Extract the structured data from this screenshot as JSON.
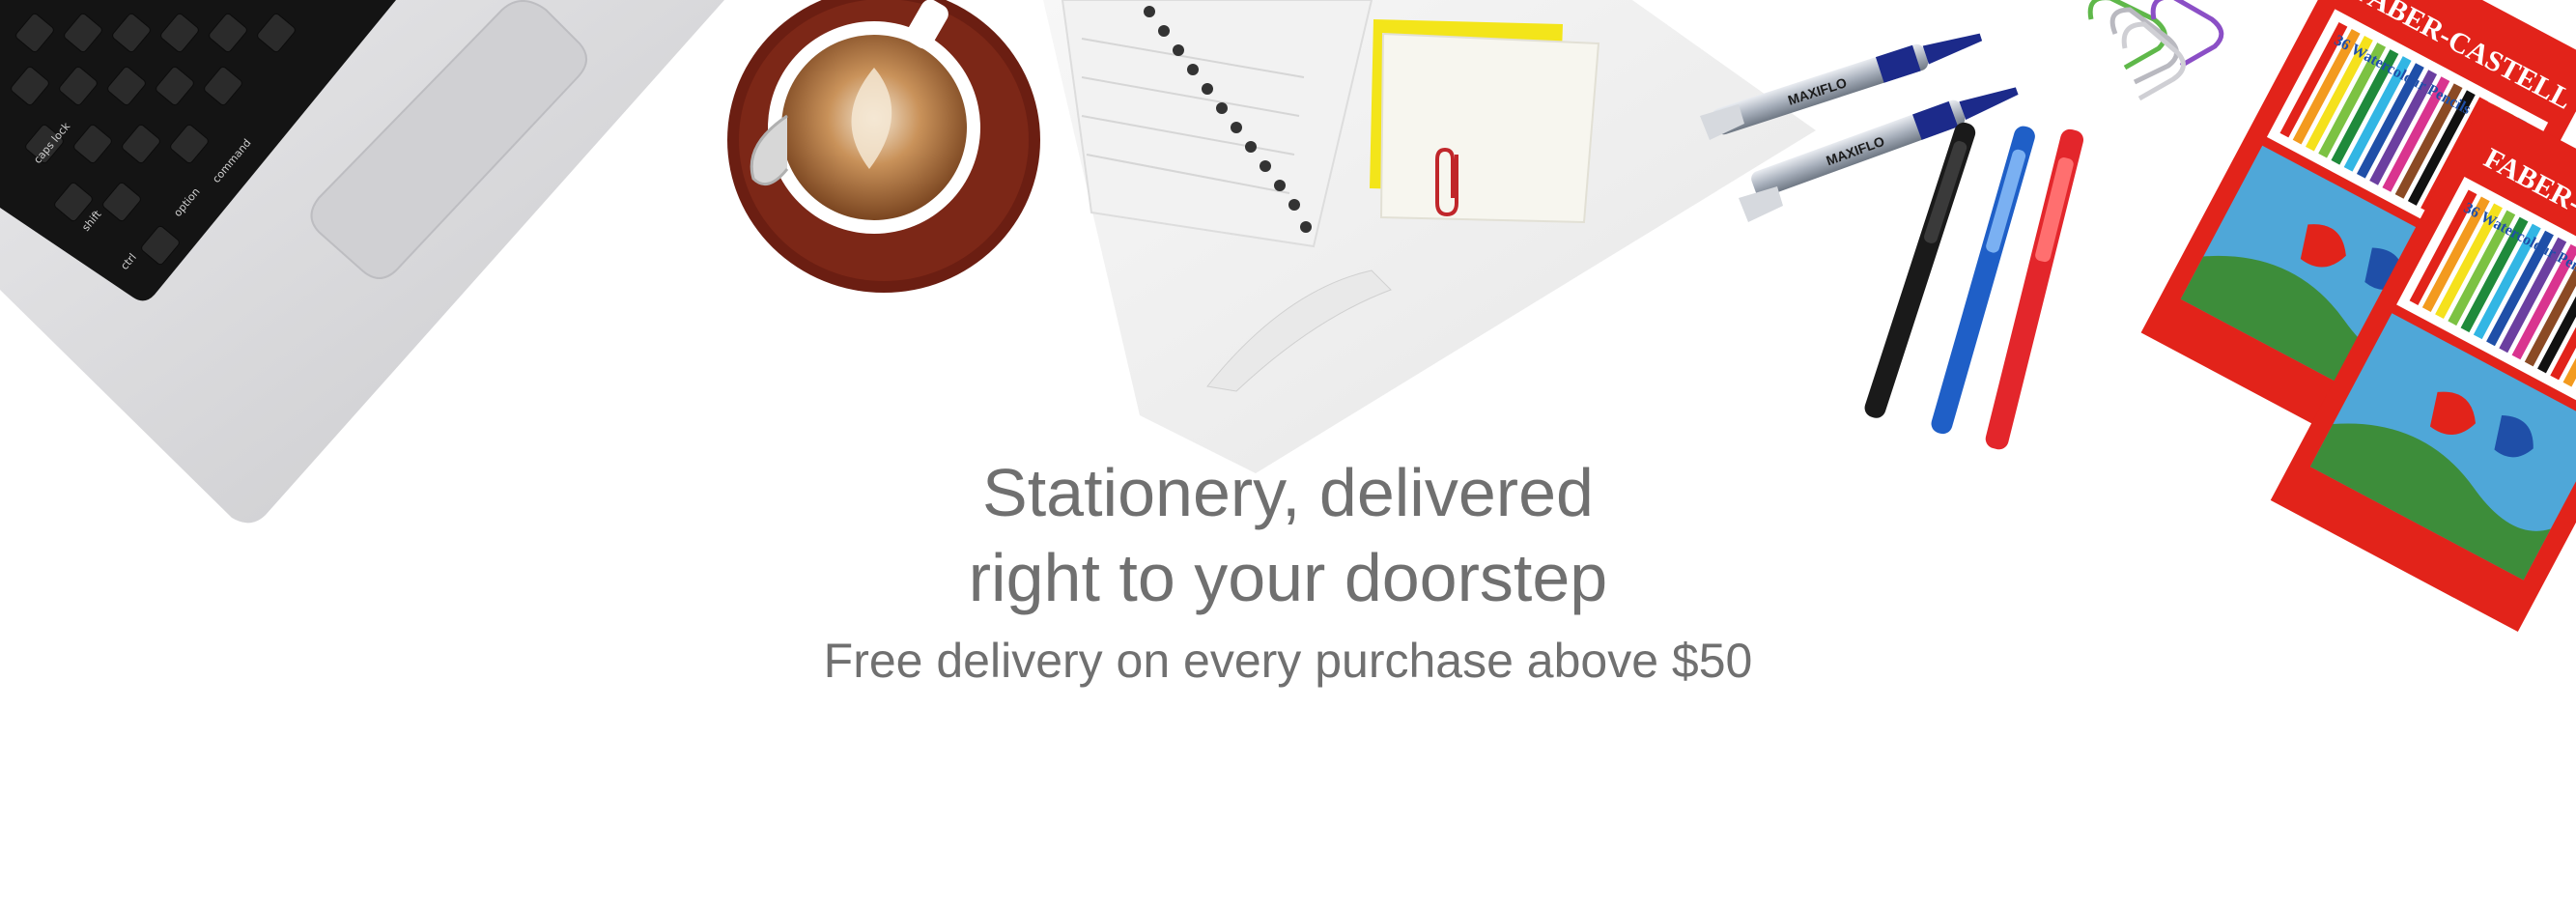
{
  "hero": {
    "headline_line1": "Stationery, delivered",
    "headline_line2": "right to your doorstep",
    "subheadline": "Free delivery on every purchase above $50"
  },
  "decor": {
    "marker_brand": "MAXIFLO",
    "pencil_brand": "FABER-CASTELL",
    "pencil_product": "36 Watercolour Pencils"
  },
  "colors": {
    "text": "#707070",
    "background": "#ffffff",
    "laptop": "#d9d9db",
    "coffee_saucer": "#6b1e12",
    "sticky_note": "#f3e51a",
    "faber_red": "#e2231a",
    "pen_blue": "#1f5fc7",
    "pen_red": "#e3262b"
  },
  "icons": [
    "laptop-icon",
    "coffee-cup-icon",
    "notebook-icon",
    "sticky-note-icon",
    "paper-clip-icon",
    "marker-icon",
    "pen-icon",
    "colored-pencil-box-icon"
  ]
}
